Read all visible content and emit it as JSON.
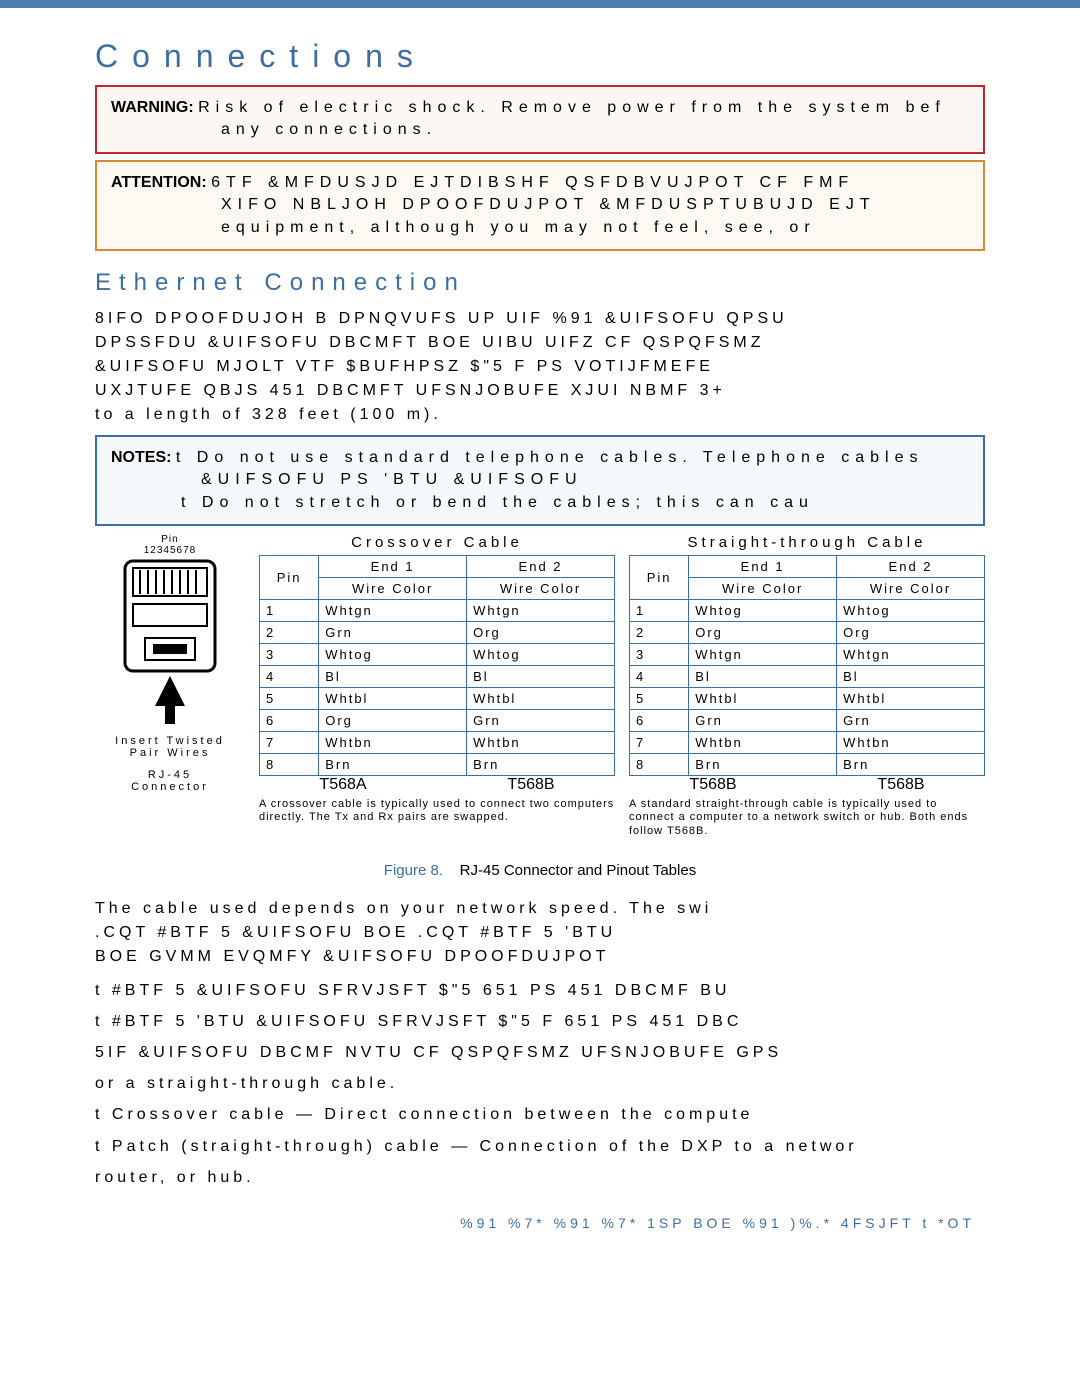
{
  "header": {
    "title": "Connections"
  },
  "warning": {
    "label": "WARNING:",
    "text1": "Risk of electric shock. Remove power from the system bef",
    "text2": "any connections."
  },
  "attention": {
    "label": "ATTENTION:",
    "text1": "6TF &MFDUSJD EJTDIBSHF QSFDBVUJPOT CF FMF",
    "text2": "XIFO NBLJOH DPOOFDUJPOT &MFDUSPTUBUJD EJT",
    "text3": "equipment, although you may not feel, see, or"
  },
  "section": {
    "title": "Ethernet Connection"
  },
  "intro": {
    "p1": "8IFO DPOOFDUJOH B DPNQVUFS UP UIF %91 &UIFSOFU QPSU",
    "p2": "DPSSFDU &UIFSOFU DBCMFT BOE UIBU UIFZ CF QSPQFSMZ",
    "p3": "&UIFSOFU MJOLT VTF $BUFHPSZ $\"5    F PS   VOTIJFMEFE",
    "p4": "UXJTUFE QBJS 451 DBCMFT UFSNJOBUFE XJUI NBMF 3+",
    "p5": "to a length of 328 feet (100 m)."
  },
  "notes": {
    "label": "NOTES:",
    "line1": "t Do not use standard telephone cables. Telephone cables",
    "line2": "&UIFSOFU PS 'BTU &UIFSOFU",
    "line3": "t Do not stretch or bend the cables; this can cau"
  },
  "connector": {
    "pin_label_top": "Pin",
    "pin_numbers": "12345678",
    "insert_label": "Insert Twisted",
    "pair_label": "Pair Wires",
    "rj_label": "RJ-45",
    "connector_label": "Connector"
  },
  "crossover": {
    "title": "Crossover Cable",
    "end1": "End 1",
    "end2": "End 2",
    "pin": "Pin",
    "wire_color": "Wire Color",
    "rows": [
      {
        "pin": "1",
        "c1": "Whtgn",
        "c2": "Whtgn"
      },
      {
        "pin": "2",
        "c1": "Grn",
        "c2": "Org"
      },
      {
        "pin": "3",
        "c1": "Whtog",
        "c2": "Whtog"
      },
      {
        "pin": "4",
        "c1": "Bl",
        "c2": "Bl"
      },
      {
        "pin": "5",
        "c1": "Whtbl",
        "c2": "Whtbl"
      },
      {
        "pin": "6",
        "c1": "Org",
        "c2": "Grn"
      },
      {
        "pin": "7",
        "c1": "Whtbn",
        "c2": "Whtbn"
      },
      {
        "pin": "8",
        "c1": "Brn",
        "c2": "Brn"
      }
    ],
    "foot1": "T568A",
    "foot2": "T568B",
    "note": "A crossover cable is typically used to connect two computers directly. The Tx and Rx pairs are swapped."
  },
  "straight": {
    "title": "Straight-through Cable",
    "end1": "End 1",
    "end2": "End 2",
    "pin": "Pin",
    "wire_color": "Wire Color",
    "rows": [
      {
        "pin": "1",
        "c1": "Whtog",
        "c2": "Whtog"
      },
      {
        "pin": "2",
        "c1": "Org",
        "c2": "Org"
      },
      {
        "pin": "3",
        "c1": "Whtgn",
        "c2": "Whtgn"
      },
      {
        "pin": "4",
        "c1": "Bl",
        "c2": "Bl"
      },
      {
        "pin": "5",
        "c1": "Whtbl",
        "c2": "Whtbl"
      },
      {
        "pin": "6",
        "c1": "Grn",
        "c2": "Grn"
      },
      {
        "pin": "7",
        "c1": "Whtbn",
        "c2": "Whtbn"
      },
      {
        "pin": "8",
        "c1": "Brn",
        "c2": "Brn"
      }
    ],
    "foot1": "T568B",
    "foot2": "T568B",
    "note": "A standard straight-through cable is typically used to connect a computer to a network switch or hub. Both ends follow T568B."
  },
  "figure": {
    "label": "Figure 8.",
    "caption": "RJ-45 Connector and Pinout Tables"
  },
  "body2": {
    "p1": "The cable used depends on your network speed. The swi",
    "p2": ".CQT  #BTF 5  &UIFSOFU BOE   .CQT  #BTF 5  'BTU",
    "p3": "BOE GVMM EVQMFY &UIFSOFU DPOOFDUJPOT"
  },
  "bullets": {
    "b1": "t   #BTF 5 &UIFSOFU SFRVJSFT $\"5   651 PS 451 DBCMF BU",
    "b2": "t   #BTF 5 'BTU &UIFSOFU SFRVJSFT $\"5   F 651 PS 451 DBC",
    "b3": "5IF &UIFSOFU DBCMF NVTU CF QSPQFSMZ UFSNJOBUFE GPS",
    "b4": "or a straight-through cable.",
    "b5": "t  Crossover cable — Direct connection between the compute",
    "b6": "t  Patch (straight-through) cable — Connection of the DXP to a networ",
    "b7": "   router, or hub."
  },
  "footer": {
    "text": "%91 %7*  %91 %7* 1SP BOE %91 )%.* 4FSJFT t *OT"
  }
}
